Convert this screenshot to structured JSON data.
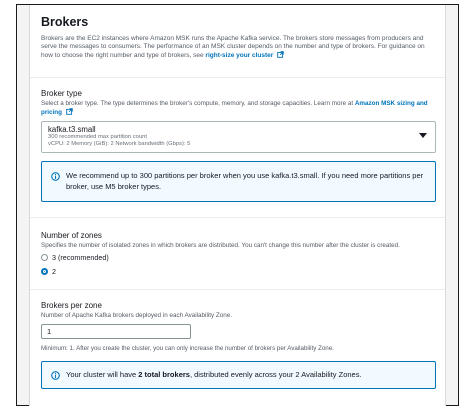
{
  "section": {
    "title": "Brokers",
    "description": "Brokers are the EC2 instances where Amazon MSK runs the Apache Kafka service. The brokers store messages from producers and serve the messages to consumers. The performance of an MSK cluster depends on the number and type of brokers. For guidance on how to choose the right number and type of brokers, see",
    "description_link": "right-size your cluster"
  },
  "broker_type": {
    "label": "Broker type",
    "description": "Select a broker type. The type determines the broker's compute, memory, and storage capacities. Learn more at",
    "description_link": "Amazon MSK sizing and pricing",
    "selected": "kafka.t3.small",
    "detail_line1": "300 recommended max partition count",
    "detail_line2": "vCPU: 2    Memory (GiB): 2    Network bandwidth (Gbps): 5",
    "info": "We recommend up to 300 partitions per broker when you use kafka.t3.small. If you need more partitions per broker, use M5 broker types."
  },
  "zones": {
    "label": "Number of zones",
    "description": "Specifies the number of isolated zones in which brokers are distributed. You can't change this number after the cluster is created.",
    "options": [
      {
        "label": "3 (recommended)",
        "selected": false
      },
      {
        "label": "2",
        "selected": true
      }
    ]
  },
  "brokers_per_zone": {
    "label": "Brokers per zone",
    "description": "Number of Apache Kafka brokers deployed in each Availability Zone.",
    "value": "1",
    "hint": "Minimum: 1. After you create the cluster, you can only increase the number of brokers per Availability Zone.",
    "info_prefix": "Your cluster will have ",
    "info_bold": "2 total brokers",
    "info_suffix": ", distributed evenly across your 2 Availability Zones."
  },
  "colors": {
    "link": "#0073bb",
    "info_bg": "#f1faff",
    "info_border": "#0073bb"
  },
  "icons": [
    "external-link-icon",
    "chevron-down-icon",
    "info-icon"
  ]
}
